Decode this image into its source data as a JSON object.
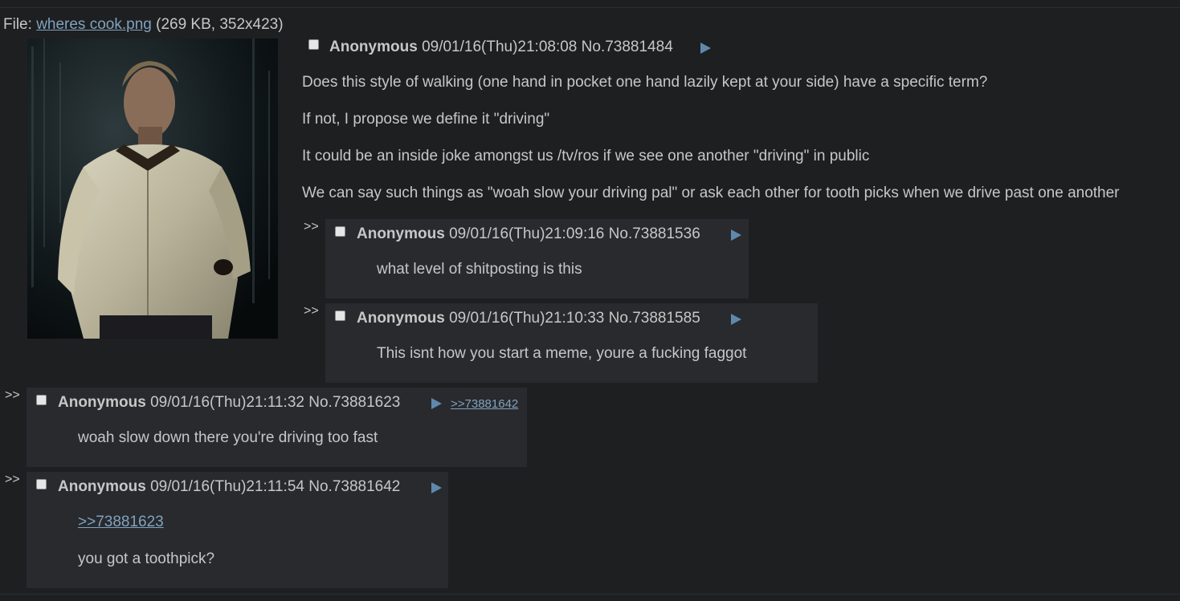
{
  "file": {
    "prefix": "File: ",
    "filename": "wheres cook.png",
    "meta": " (269 KB, 352x423)"
  },
  "op": {
    "name": "Anonymous",
    "datetime": "09/01/16(Thu)21:08:08",
    "number": "No.73881484",
    "lines": [
      "Does this style of walking (one hand in pocket one hand lazily kept at your side) have a specific term?",
      "If not, I propose we define it \"driving\"",
      "It could be an inside joke amongst us /tv/ros if we see one another \"driving\" in public",
      "We can say such things as \"woah slow your driving pal\" or ask each other for tooth picks when we drive past one another"
    ]
  },
  "replies": [
    {
      "arrows": ">>",
      "name": "Anonymous",
      "datetime": "09/01/16(Thu)21:09:16",
      "number": "No.73881536",
      "text": "what level of shitposting is this"
    },
    {
      "arrows": ">>",
      "name": "Anonymous",
      "datetime": "09/01/16(Thu)21:10:33",
      "number": "No.73881585",
      "text": "This isnt how you start a meme, youre a fucking faggot"
    },
    {
      "arrows": ">>",
      "name": "Anonymous",
      "datetime": "09/01/16(Thu)21:11:32",
      "number": "No.73881623",
      "backlink": ">>73881642",
      "text": "woah slow down there you're driving too fast"
    },
    {
      "arrows": ">>",
      "name": "Anonymous",
      "datetime": "09/01/16(Thu)21:11:54",
      "number": "No.73881642",
      "quote": ">>73881623",
      "text": "you got a toothpick?"
    }
  ],
  "colors": {
    "background": "#1d1f21",
    "reply_background": "#282a2e",
    "text": "#c5c8c6",
    "link": "#81a2be",
    "menu_arrow": "#5f89ac"
  }
}
